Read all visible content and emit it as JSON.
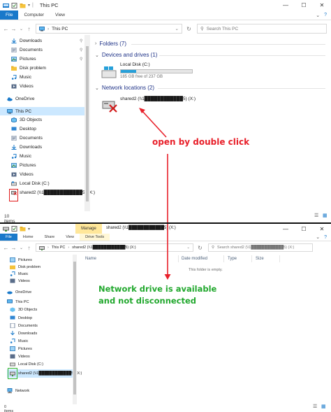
{
  "top": {
    "title": "This PC",
    "ribbon_tabs": [
      "File",
      "Computer",
      "View"
    ],
    "address": "This PC",
    "search_placeholder": "Search This PC",
    "quick_access": [
      {
        "label": "Downloads",
        "icon": "download-arrow-icon",
        "pinned": true
      },
      {
        "label": "Documents",
        "icon": "documents-icon",
        "pinned": true
      },
      {
        "label": "Pictures",
        "icon": "pictures-icon",
        "pinned": true
      },
      {
        "label": "Disk problem",
        "icon": "folder-icon",
        "pinned": false
      },
      {
        "label": "Music",
        "icon": "music-icon",
        "pinned": false
      },
      {
        "label": "Videos",
        "icon": "videos-icon",
        "pinned": false
      }
    ],
    "onedrive": "OneDrive",
    "this_pc": "This PC",
    "this_pc_items": [
      "3D Objects",
      "Desktop",
      "Documents",
      "Downloads",
      "Music",
      "Pictures",
      "Videos",
      "Local Disk (C:)"
    ],
    "network_drive_nav": "shared2 (\\\\1████████████5) (X:)",
    "status": "10 items",
    "groups": {
      "folders": "Folders (7)",
      "devices": "Devices and drives (1)",
      "network": "Network locations (2)"
    },
    "local_disk": {
      "name": "Local Disk (C:)",
      "free": "185 GB free of 237 GB",
      "used_fraction": 0.22
    },
    "network_drive": "shared2 (\\\\1████████████5) (X:)"
  },
  "annotation_top": "open by double click",
  "bottom": {
    "title": "shared2 (\\\\1████████████5) (X:)",
    "manage_tab": "Manage",
    "drive_tools_tab": "Drive Tools",
    "ribbon_tabs": [
      "File",
      "Home",
      "Share",
      "View"
    ],
    "breadcrumb": [
      "This PC",
      "shared2 (\\\\1████████████5) (X:)"
    ],
    "search_placeholder": "Search shared2 (\\\\1████████████5) (X:)",
    "nav_items": [
      "Pictures",
      "Disk problem",
      "Music",
      "Videos"
    ],
    "onedrive": "OneDrive",
    "this_pc": "This PC",
    "this_pc_items": [
      "3D Objects",
      "Desktop",
      "Documents",
      "Downloads",
      "Music",
      "Pictures",
      "Videos",
      "Local Disk (C:)"
    ],
    "network_drive_nav": "shared2 (\\\\1████████████5) (X:)",
    "network": "Network",
    "columns": [
      "Name",
      "Date modified",
      "Type",
      "Size"
    ],
    "empty_text": "This folder is empty.",
    "status": "0 items"
  },
  "annotation_bottom": [
    "Network drive is available",
    "and not disconnected"
  ],
  "colors": {
    "accent": "#1979ca",
    "annotation_red": "#e8202a",
    "annotation_green": "#22a82e",
    "selection": "#cce8ff"
  }
}
